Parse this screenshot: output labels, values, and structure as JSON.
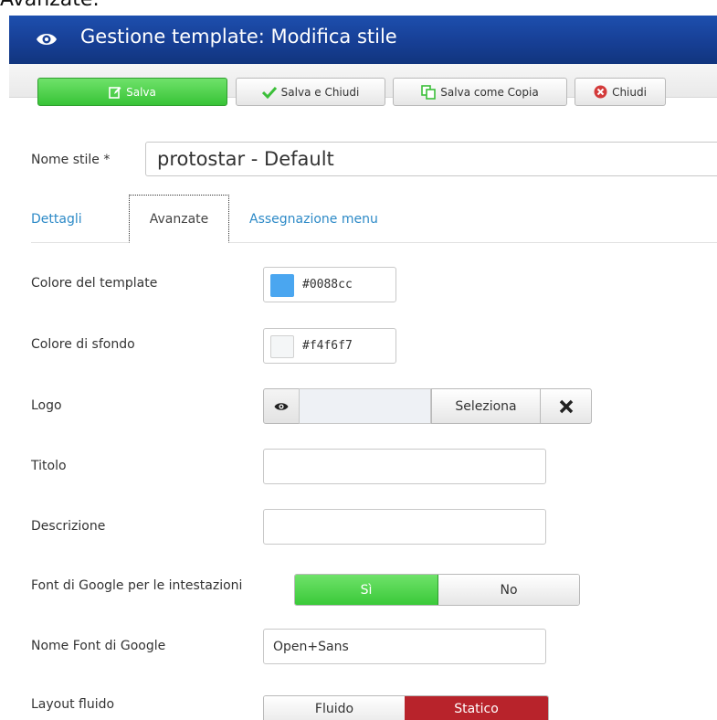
{
  "caption": "Avanzate:",
  "header": {
    "title": "Gestione template: Modifica stile",
    "icon": "eye-icon"
  },
  "toolbar": {
    "save_label": "Salva",
    "save_close_label": "Salva e Chiudi",
    "save_copy_label": "Salva come Copia",
    "close_label": "Chiudi"
  },
  "style_name": {
    "label": "Nome stile *",
    "value": "protostar - Default"
  },
  "tabs": [
    {
      "label": "Dettagli",
      "active": false
    },
    {
      "label": "Avanzate",
      "active": true
    },
    {
      "label": "Assegnazione menu",
      "active": false
    }
  ],
  "fields": {
    "template_color": {
      "label": "Colore del template",
      "value": "#0088cc",
      "swatch": "#4aa6f0"
    },
    "background_color": {
      "label": "Colore di sfondo",
      "value": "#f4f6f7",
      "swatch": "#f4f6f7"
    },
    "logo": {
      "label": "Logo",
      "select_label": "Seleziona",
      "value": ""
    },
    "title": {
      "label": "Titolo",
      "value": ""
    },
    "description": {
      "label": "Descrizione",
      "value": ""
    },
    "google_font": {
      "label": "Font di Google per le intestazioni",
      "yes_label": "Sì",
      "no_label": "No",
      "selected": "Sì"
    },
    "google_font_name": {
      "label": "Nome Font di Google",
      "value": "Open+Sans"
    },
    "fluid_layout": {
      "label": "Layout fluido",
      "fluid_label": "Fluido",
      "static_label": "Statico",
      "selected": "Statico"
    }
  },
  "colors": {
    "header_bg": "#173f95",
    "save_green": "#3ac939",
    "tab_link": "#2d8ac7",
    "static_red": "#b8232b"
  }
}
